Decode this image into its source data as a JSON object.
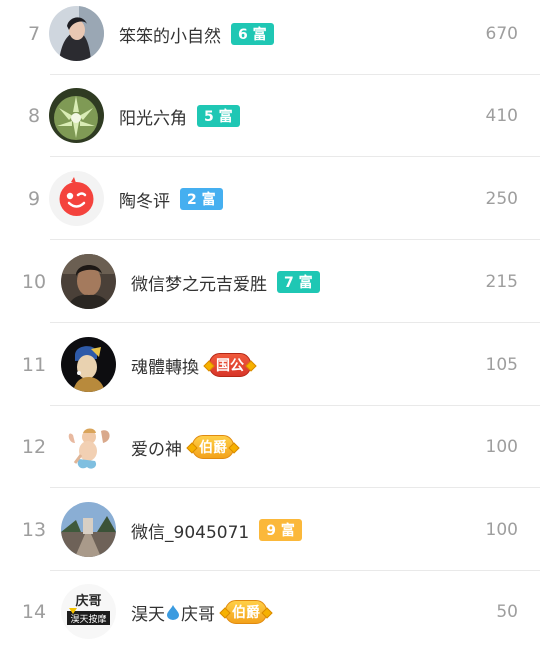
{
  "rows": [
    {
      "rank": "7",
      "name": "笨笨的小自然",
      "badge": "6 富",
      "badge_style": "teal",
      "value": "670",
      "avatar_icon": "woman-profile-avatar"
    },
    {
      "rank": "8",
      "name": "阳光六角",
      "badge": "5 富",
      "badge_style": "teal",
      "value": "410",
      "avatar_icon": "succulent-plant-avatar"
    },
    {
      "rank": "9",
      "name": "陶冬评",
      "badge": "2 富",
      "badge_style": "blue",
      "value": "250",
      "avatar_icon": "red-smiley-avatar"
    },
    {
      "rank": "10",
      "name": "微信梦之元吉爱胜",
      "badge": "7 富",
      "badge_style": "teal",
      "value": "215",
      "avatar_icon": "man-portrait-avatar"
    },
    {
      "rank": "11",
      "name": "魂體轉換",
      "badge": "国公",
      "badge_style": "noble-red",
      "value": "105",
      "avatar_icon": "pearl-earring-girl-avatar"
    },
    {
      "rank": "12",
      "name": "爱の神",
      "badge": "伯爵",
      "badge_style": "noble-gold",
      "value": "100",
      "avatar_icon": "cupid-angel-avatar"
    },
    {
      "rank": "13",
      "name": "微信_9045071",
      "badge": "9 富",
      "badge_style": "orange",
      "value": "100",
      "avatar_icon": "street-scene-avatar"
    },
    {
      "rank": "14",
      "name": "淏天",
      "name_suffix": "庆哥",
      "badge": "伯爵",
      "badge_style": "noble-gold",
      "value": "50",
      "avatar_icon": "qingge-logo-avatar",
      "avatar_text": "庆哥",
      "avatar_subtext": "淏天按摩"
    }
  ]
}
